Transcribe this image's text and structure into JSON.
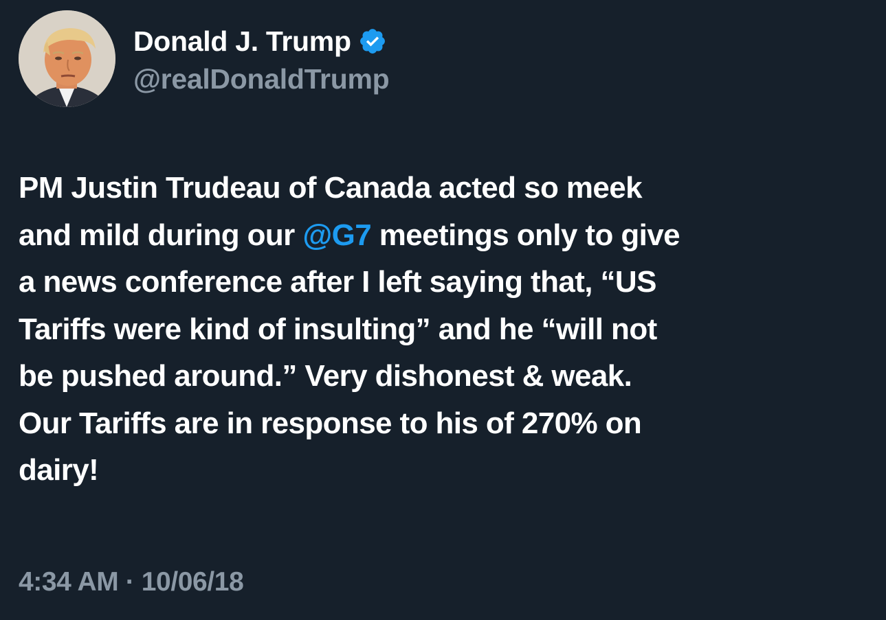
{
  "author": {
    "display_name": "Donald J. Trump",
    "handle": "@realDonaldTrump",
    "verified": true,
    "badge_color": "#1d9bf0"
  },
  "tweet": {
    "line1": "PM Justin Trudeau of Canada acted so meek",
    "line2_before": "and mild during our ",
    "line2_mention": "@G7",
    "line2_after": " meetings only to give",
    "line3": "a news conference after I left saying that, “US",
    "line4": "Tariffs were kind of insulting” and he “will not",
    "line5": "be pushed around.” Very dishonest & weak.",
    "line6": "Our Tariffs are in response to his of 270% on",
    "line7": "dairy!"
  },
  "meta": {
    "timestamp": "4:34 AM · 10/06/18"
  },
  "colors": {
    "background": "#16202b",
    "text": "#ffffff",
    "secondary_text": "#8b98a5",
    "link": "#1d9bf0"
  }
}
